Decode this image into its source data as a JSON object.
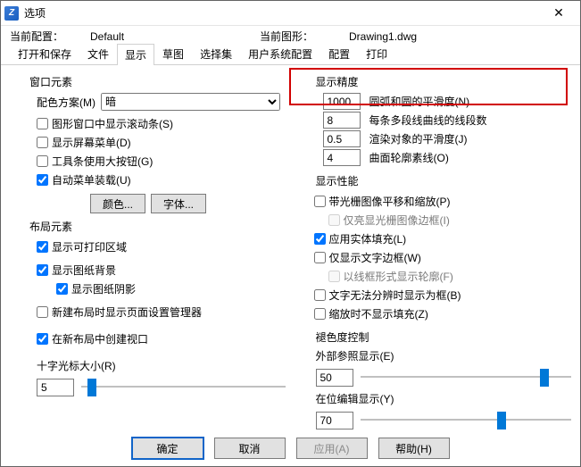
{
  "window": {
    "title": "选项"
  },
  "info": {
    "current_config_label": "当前配置：",
    "current_config_value": "Default",
    "current_drawing_label": "当前图形：",
    "current_drawing_value": "Drawing1.dwg"
  },
  "tabs": {
    "open_save": "打开和保存",
    "file": "文件",
    "display": "显示",
    "sketch": "草图",
    "selection": "选择集",
    "user_config": "用户系统配置",
    "config": "配置",
    "print": "打印"
  },
  "left": {
    "group_window": "窗口元素",
    "color_scheme_label": "配色方案(M)",
    "color_scheme_value": "暗",
    "scrollbars": "图形窗口中显示滚动条(S)",
    "screen_menu": "显示屏幕菜单(D)",
    "big_buttons": "工具条使用大按钮(G)",
    "auto_menu": "自动菜单装载(U)",
    "color_btn": "颜色...",
    "font_btn": "字体...",
    "group_layout": "布局元素",
    "show_printable": "显示可打印区域",
    "show_paper": "显示图纸背景",
    "show_shadow": "显示图纸阴影",
    "new_layout_pagesetup": "新建布局时显示页面设置管理器",
    "create_viewport": "在新布局中创建视口",
    "cross_size_label": "十字光标大小(R)",
    "cross_size_value": "5"
  },
  "right": {
    "group_precision": "显示精度",
    "arc_value": "1000",
    "arc_label": "圆弧和圆的平滑度(N)",
    "polyseg_value": "8",
    "polyseg_label": "每条多段线曲线的线段数",
    "render_value": "0.5",
    "render_label": "渲染对象的平滑度(J)",
    "surface_value": "4",
    "surface_label": "曲面轮廓素线(O)",
    "group_perf": "显示性能",
    "pan_zoom_raster": "带光栅图像平移和缩放(P)",
    "highlight_raster_frame": "仅亮显光栅图像边框(I)",
    "solid_fill": "应用实体填充(L)",
    "text_outline": "仅显示文字边框(W)",
    "wireframe_silhouette": "以线框形式显示轮廓(F)",
    "text_boxes": "文字无法分辨时显示为框(B)",
    "no_fill_on_zoom": "缩放时不显示填充(Z)",
    "group_fade": "褪色度控制",
    "xref_fade_label": "外部参照显示(E)",
    "xref_fade_value": "50",
    "inplace_fade_label": "在位编辑显示(Y)",
    "inplace_fade_value": "70"
  },
  "footer": {
    "ok": "确定",
    "cancel": "取消",
    "apply": "应用(A)",
    "help": "帮助(H)"
  }
}
